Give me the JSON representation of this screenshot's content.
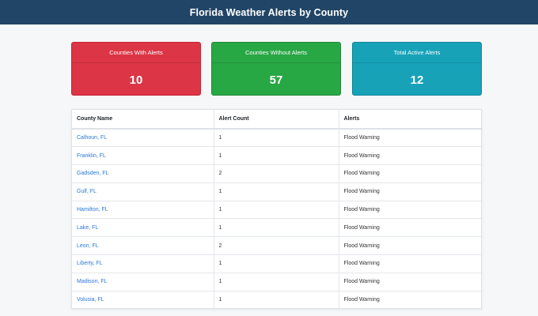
{
  "header": {
    "title": "Florida Weather Alerts by County"
  },
  "summary": {
    "with_alerts": {
      "label": "Counties With Alerts",
      "value": "10"
    },
    "without_alerts": {
      "label": "Counties Without Alerts",
      "value": "57"
    },
    "total_active": {
      "label": "Total Active Alerts",
      "value": "12"
    }
  },
  "table": {
    "headers": [
      "County Name",
      "Alert Count",
      "Alerts"
    ],
    "rows": [
      {
        "county": "Calhoun, FL",
        "count": "1",
        "alerts": "Flood Warning"
      },
      {
        "county": "Franklin, FL",
        "count": "1",
        "alerts": "Flood Warning"
      },
      {
        "county": "Gadsden, FL",
        "count": "2",
        "alerts": "Flood Warning"
      },
      {
        "county": "Gulf, FL",
        "count": "1",
        "alerts": "Flood Warning"
      },
      {
        "county": "Hamilton, FL",
        "count": "1",
        "alerts": "Flood Warning"
      },
      {
        "county": "Lake, FL",
        "count": "1",
        "alerts": "Flood Warning"
      },
      {
        "county": "Leon, FL",
        "count": "2",
        "alerts": "Flood Warning"
      },
      {
        "county": "Liberty, FL",
        "count": "1",
        "alerts": "Flood Warning"
      },
      {
        "county": "Madison, FL",
        "count": "1",
        "alerts": "Flood Warning"
      },
      {
        "county": "Volusia, FL",
        "count": "1",
        "alerts": "Flood Warning"
      }
    ]
  },
  "colors": {
    "header_bg": "#214566",
    "with_alerts": "#dc3545",
    "without_alerts": "#28a745",
    "total_active": "#17a2b8",
    "link": "#2a78d4"
  }
}
